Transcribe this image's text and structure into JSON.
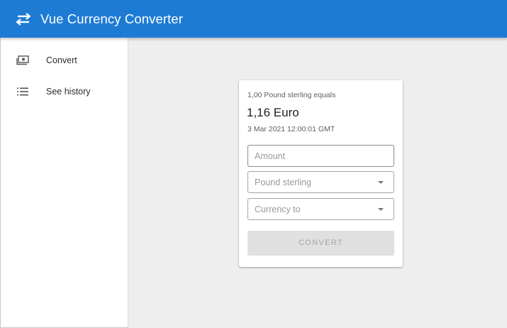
{
  "appbar": {
    "title": "Vue Currency Converter",
    "logo_icon": "swap-horizontal-icon",
    "color": "#1e7bd4"
  },
  "sidebar": {
    "items": [
      {
        "label": "Convert",
        "icon": "cash-icon"
      },
      {
        "label": "See history",
        "icon": "list-icon"
      }
    ]
  },
  "card": {
    "rate_caption": "1,00 Pound sterling equals",
    "rate_value": "1,16 Euro",
    "timestamp": "3 Mar 2021 12:00:01 GMT",
    "amount_placeholder": "Amount",
    "amount_value": "",
    "from_currency": "Pound sterling",
    "to_currency_placeholder": "Currency to",
    "convert_label": "CONVERT",
    "convert_disabled": true
  }
}
